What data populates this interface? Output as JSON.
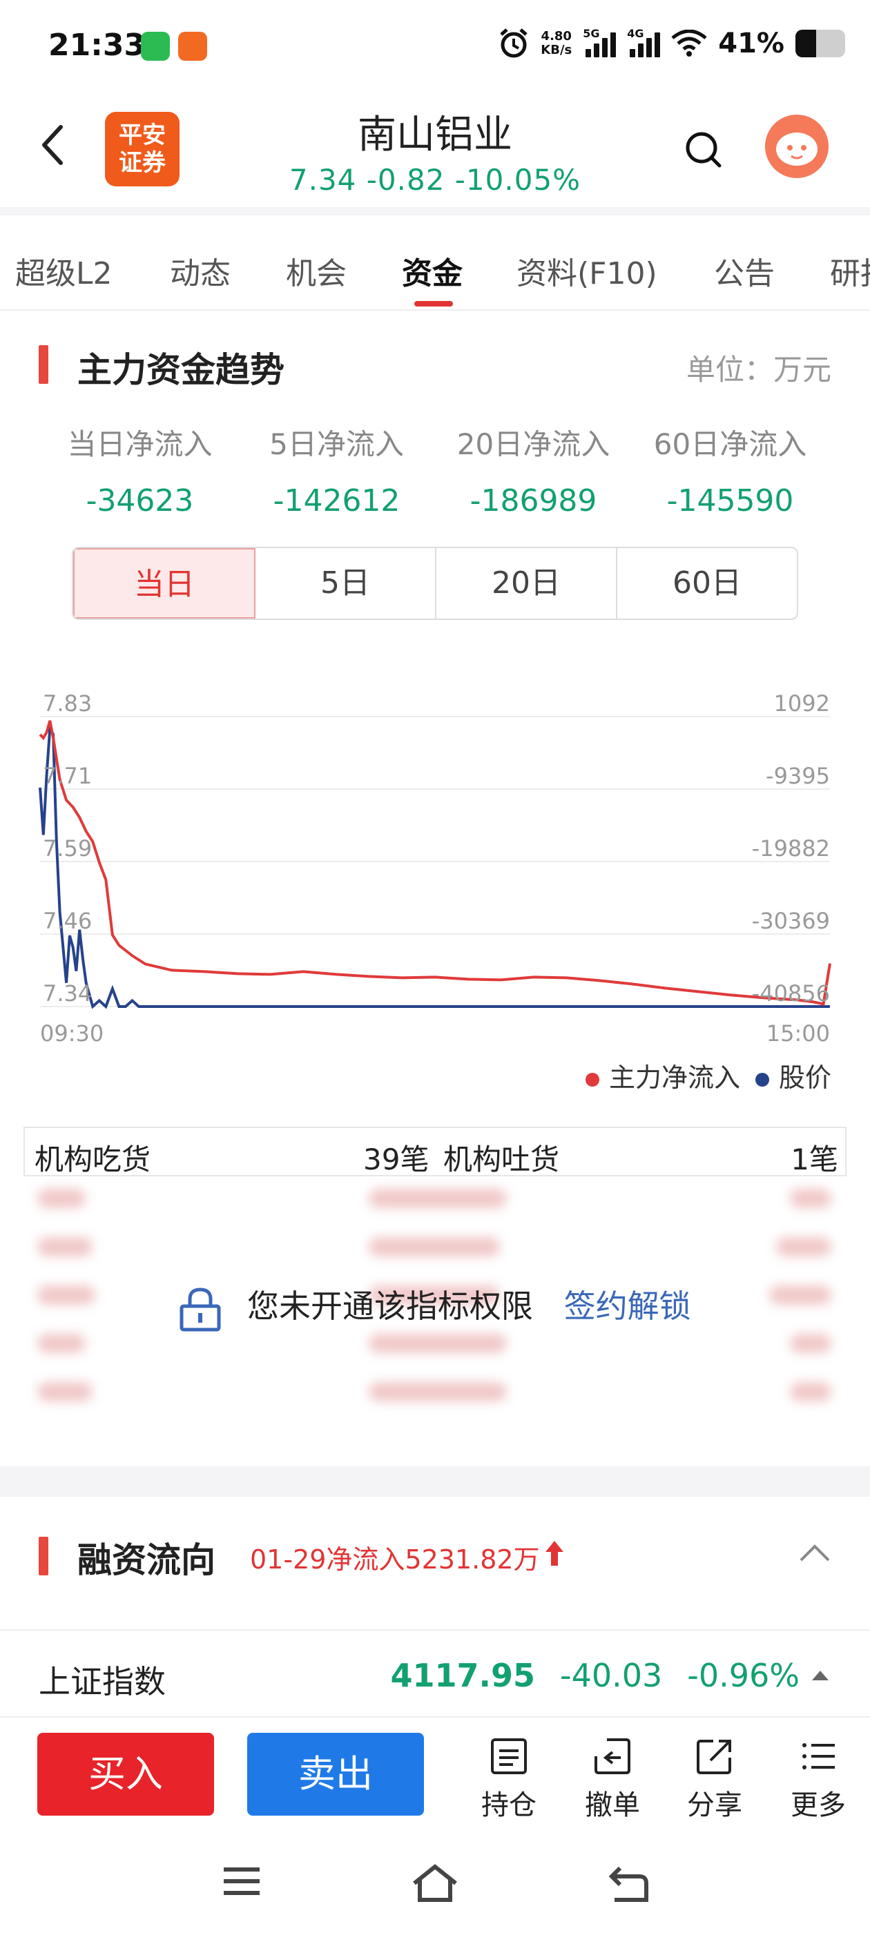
{
  "status_bar": {
    "time": "21:33",
    "net_speed_value": "4.80",
    "net_speed_unit": "KB/s",
    "sig1": "5G",
    "sig2": "4G",
    "battery": "41%"
  },
  "header": {
    "logo_line1": "平安",
    "logo_line2": "证券",
    "title": "南山铝业",
    "quote": "7.34  -0.82  -10.05%"
  },
  "tabs": [
    "超级L2",
    "动态",
    "机会",
    "资金",
    "资料(F10)",
    "公告",
    "研报"
  ],
  "active_tab": "资金",
  "main_flow": {
    "title": "主力资金趋势",
    "unit": "单位：万元",
    "labels": [
      "当日净流入",
      "5日净流入",
      "20日净流入",
      "60日净流入"
    ],
    "values": [
      "-34623",
      "-142612",
      "-186989",
      "-145590"
    ],
    "periods": [
      "当日",
      "5日",
      "20日",
      "60日"
    ]
  },
  "chart_data": {
    "type": "line",
    "title": "",
    "x_start": "09:30",
    "x_end": "15:00",
    "y_left_ticks": [
      "7.83",
      "7.71",
      "7.59",
      "7.46",
      "7.34"
    ],
    "y_right_ticks": [
      "1092",
      "-9395",
      "-19882",
      "-30369",
      "-40856"
    ],
    "ylim_left": [
      7.34,
      7.83
    ],
    "ylim_right": [
      -40856,
      1092
    ],
    "grid": true,
    "legend_position": "bottom-right",
    "colors": {
      "main": "#e03a3a",
      "price": "#26428b"
    },
    "series": [
      {
        "name": "主力净流入",
        "x": [
          0,
          1,
          2,
          3,
          4,
          5,
          6,
          8,
          10,
          12,
          14,
          16,
          18,
          20,
          22,
          24,
          28,
          32,
          40,
          50,
          60,
          70,
          80,
          90,
          100,
          110,
          120,
          130,
          140,
          150,
          160,
          170,
          180,
          190,
          200,
          210,
          220,
          230,
          235,
          238,
          240
        ],
        "values": [
          -1500,
          -2000,
          -1200,
          500,
          -2000,
          -5000,
          -8000,
          -11000,
          -12000,
          -13500,
          -15500,
          -17000,
          -20000,
          -22500,
          -30500,
          -32000,
          -33500,
          -34700,
          -35600,
          -35800,
          -36100,
          -36200,
          -35800,
          -36200,
          -36500,
          -36700,
          -36600,
          -36900,
          -37000,
          -36600,
          -36700,
          -37100,
          -37600,
          -38200,
          -38700,
          -39200,
          -39600,
          -39900,
          -40200,
          -40500,
          -34623
        ]
      },
      {
        "name": "股价",
        "x": [
          0,
          1,
          2,
          3,
          4,
          5,
          6,
          8,
          9,
          10,
          11,
          12,
          13,
          14,
          15,
          16,
          18,
          20,
          22,
          24,
          26,
          28,
          30,
          240
        ],
        "values": [
          7.71,
          7.63,
          7.73,
          7.81,
          7.8,
          7.62,
          7.5,
          7.38,
          7.46,
          7.44,
          7.4,
          7.47,
          7.42,
          7.38,
          7.36,
          7.34,
          7.35,
          7.34,
          7.37,
          7.34,
          7.34,
          7.35,
          7.34,
          7.34
        ]
      }
    ]
  },
  "institution": {
    "buy_label": "机构吃货",
    "buy_count": "39笔",
    "sell_label": "机构吐货",
    "sell_count": "1笔",
    "lock_text": "您未开通该指标权限",
    "unlock_link": "签约解锁"
  },
  "financing": {
    "title": "融资流向",
    "note": "01-29净流入5231.82万"
  },
  "index_bar": {
    "name": "上证指数",
    "value": "4117.95",
    "change": "-40.03",
    "pct": "-0.96%"
  },
  "trade_bar": {
    "buy": "买入",
    "sell": "卖出",
    "tools": [
      "持仓",
      "撤单",
      "分享",
      "更多"
    ]
  }
}
